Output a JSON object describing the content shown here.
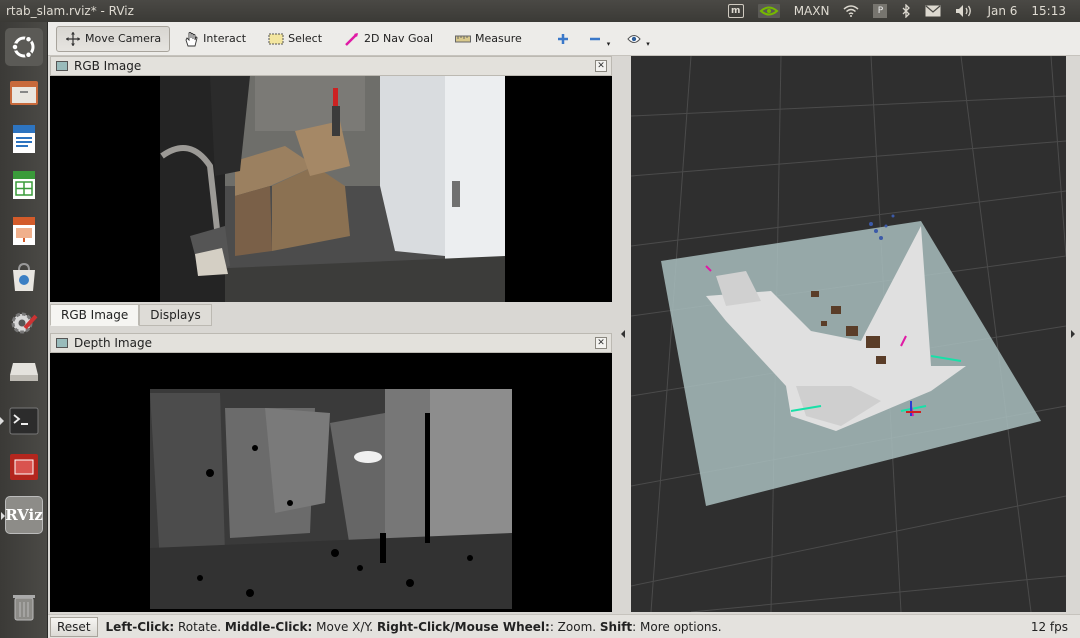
{
  "window": {
    "title": "rtab_slam.rviz* - RViz"
  },
  "tray": {
    "maxn": "MAXN",
    "p_label": "P",
    "date": "Jan 6",
    "time": "15:13"
  },
  "toolbar": {
    "move_camera": "Move Camera",
    "interact": "Interact",
    "select": "Select",
    "nav_goal": "2D Nav Goal",
    "measure": "Measure"
  },
  "panels": {
    "rgb_title": "RGB Image",
    "depth_title": "Depth Image"
  },
  "tabs": [
    {
      "label": "RGB Image"
    },
    {
      "label": "Displays"
    }
  ],
  "status": {
    "reset": "Reset",
    "h1": "Left-Click:",
    "t1": " Rotate. ",
    "h2": "Middle-Click:",
    "t2": " Move X/Y. ",
    "h3": "Right-Click/Mouse Wheel:",
    "t3": ": Zoom. ",
    "h4": "Shift",
    "t4": ": More options.",
    "fps": "12 fps"
  },
  "launcher_icons": [
    "ubuntu-dash-icon",
    "files-icon",
    "writer-icon",
    "calc-icon",
    "impress-icon",
    "software-center-icon",
    "settings-icon",
    "drive-icon",
    "terminal-icon",
    "app-icon",
    "rviz-icon",
    "trash-icon"
  ],
  "rviz_logo_text": "RViz"
}
